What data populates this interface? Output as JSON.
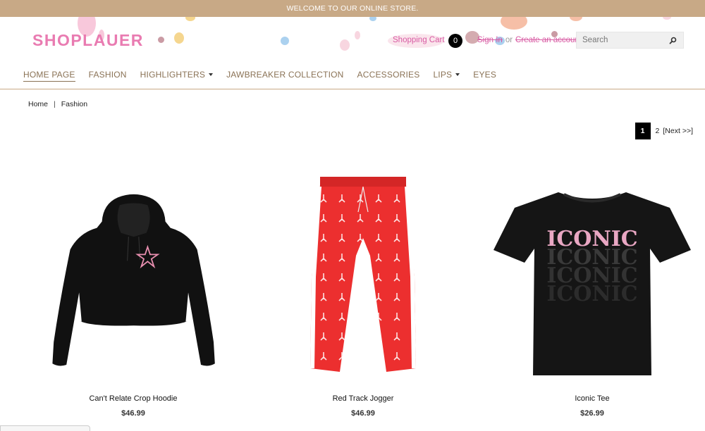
{
  "announcement": "WELCOME TO OUR ONLINE STORE.",
  "brand": {
    "logo": "SHOPLAUER"
  },
  "header": {
    "cart_label": "Shopping Cart",
    "cart_count": "0",
    "sign_in": "Sign In",
    "or_text": "or",
    "create_account": "Create an account",
    "search_placeholder": "Search",
    "search_icon": "magnifier-icon"
  },
  "nav": {
    "items": [
      {
        "label": "HOME PAGE",
        "active": true
      },
      {
        "label": "FASHION"
      },
      {
        "label": "HIGHLIGHTERS",
        "dropdown": true
      },
      {
        "label": "JAWBREAKER COLLECTION"
      },
      {
        "label": "ACCESSORIES"
      },
      {
        "label": "LIPS",
        "dropdown": true
      },
      {
        "label": "EYES"
      }
    ]
  },
  "breadcrumb": {
    "home": "Home",
    "current": "Fashion"
  },
  "pagination": {
    "current": "1",
    "next_page": "2",
    "next_label": "[Next >>]"
  },
  "products": [
    {
      "name": "Can't Relate Crop Hoodie",
      "price": "$46.99",
      "image": "black-crop-hoodie"
    },
    {
      "name": "Red Track Jogger",
      "price": "$46.99",
      "image": "red-track-jogger"
    },
    {
      "name": "Iconic Tee",
      "price": "$26.99",
      "image": "black-iconic-tee",
      "graphic_text": "ICONIC"
    }
  ],
  "colors": {
    "announcement_bg": "#c8a986",
    "logo": "#e97bb1",
    "link": "#d85aa3",
    "nav_text": "#8a7255"
  }
}
